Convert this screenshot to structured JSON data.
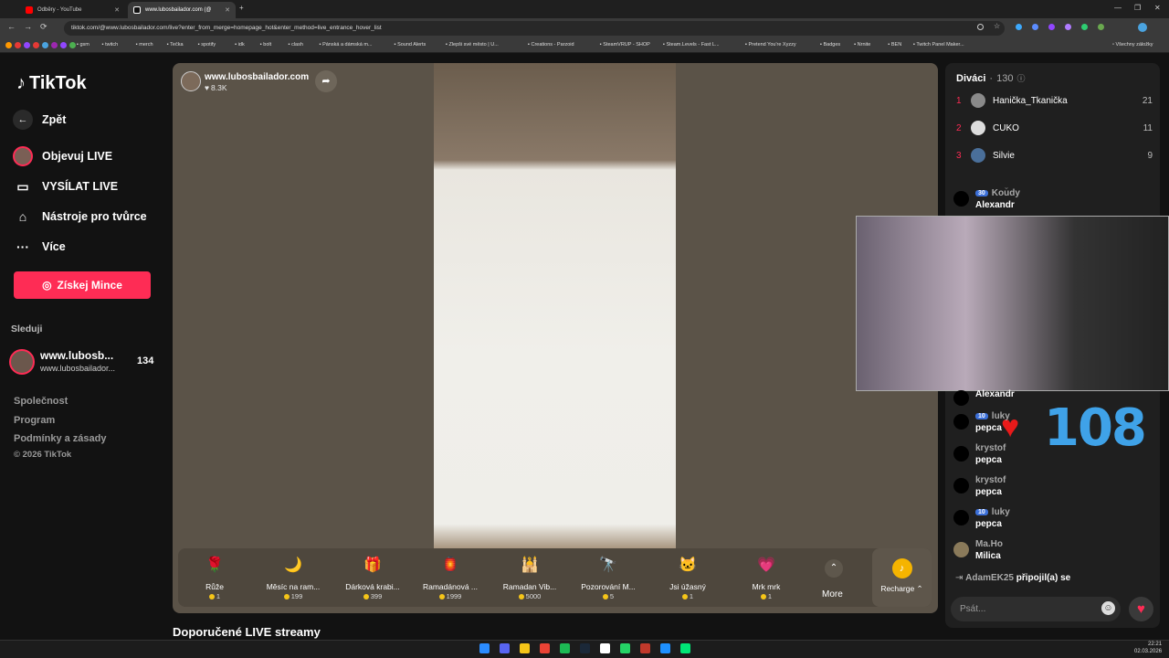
{
  "browser": {
    "tabs": [
      {
        "title": "Odběry - YouTube",
        "color": "#ff0000"
      },
      {
        "title": "www.lubosbailador.com (@",
        "color": "#111111"
      }
    ],
    "url": "tiktok.com/@www.lubosbailador.com/live?enter_from_merge=homepage_hot&enter_method=live_entrance_hover_list",
    "bookmarks": [
      "gsm",
      "twitch",
      "merch",
      "Tečka",
      "spotify",
      "idk",
      "bolt",
      "clash",
      "Pánská a dámská m...",
      "Sound Alerts",
      "Zlepši své město | U...",
      "Creations - Parzoid",
      "SteamVRUP - SHOP",
      "Steam.Levels - Fast L...",
      "Pretend You're Xyzzy",
      "Badges",
      "Nrnite",
      "BEN",
      "Twitch Panel Maker..."
    ],
    "all_bookmarks": "Všechny záložky"
  },
  "sidebar": {
    "logo": "TikTok",
    "back": "Zpět",
    "items": [
      {
        "label": "Objevuj LIVE",
        "icon": "avatar"
      },
      {
        "label": "VYSÍLAT LIVE",
        "icon": "camera-icon"
      },
      {
        "label": "Nástroje pro tvůrce",
        "icon": "house-icon"
      },
      {
        "label": "Více",
        "icon": "more-icon"
      }
    ],
    "coins_button": "Získej Mince",
    "following_title": "Sleduji",
    "following": {
      "name": "www.lubosb...",
      "handle": "www.lubosbailador...",
      "viewers": "134"
    },
    "footer": [
      "Společnost",
      "Program",
      "Podmínky a zásady"
    ],
    "copyright": "© 2026 TikTok"
  },
  "stream": {
    "host": "www.lubosbailador.com",
    "likes": "8.3K",
    "recommended_heading": "Doporučené LIVE streamy"
  },
  "gifts": [
    {
      "name": "Růže",
      "price": "1",
      "emoji": "🌹"
    },
    {
      "name": "Měsíc na ram...",
      "price": "199",
      "emoji": "🌙"
    },
    {
      "name": "Dárková krabi...",
      "price": "399",
      "emoji": "🎁"
    },
    {
      "name": "Ramadánová ...",
      "price": "1999",
      "emoji": "🏮"
    },
    {
      "name": "Ramadan Vib...",
      "price": "5000",
      "emoji": "🕌"
    },
    {
      "name": "Pozorování M...",
      "price": "5",
      "emoji": "🔭"
    },
    {
      "name": "Jsi úžasný",
      "price": "1",
      "emoji": "🐱"
    },
    {
      "name": "Mrk mrk",
      "price": "1",
      "emoji": "💗"
    }
  ],
  "gifts_more": "More",
  "recharge": "Recharge",
  "viewers_panel": {
    "title": "Diváci",
    "count": "130",
    "ranks": [
      {
        "rank": "1",
        "name": "Hanička_Tkanička",
        "score": "21"
      },
      {
        "rank": "2",
        "name": "CUKO",
        "score": "11"
      },
      {
        "rank": "3",
        "name": "Silvie",
        "score": "9"
      }
    ]
  },
  "chat": [
    {
      "user": "Koudy",
      "badge": "30",
      "msg": "Alexandr"
    },
    {
      "user": "",
      "badge": "",
      "msg": "Alexandr"
    },
    {
      "user": "luky",
      "badge": "10",
      "msg": "pepca"
    },
    {
      "user": "krystof",
      "badge": "",
      "msg": "pepca"
    },
    {
      "user": "krystof",
      "badge": "",
      "msg": "pepca"
    },
    {
      "user": "luky",
      "badge": "10",
      "msg": "pepca"
    },
    {
      "user": "Ma.Ho",
      "badge": "",
      "msg": "Milica"
    }
  ],
  "join": {
    "user": "AdamEK25",
    "text": "připojil(a) se"
  },
  "chat_input_placeholder": "Psát...",
  "overlay_counter": "108",
  "taskbar": {
    "time": "22:21",
    "date": "02.03.2026"
  }
}
